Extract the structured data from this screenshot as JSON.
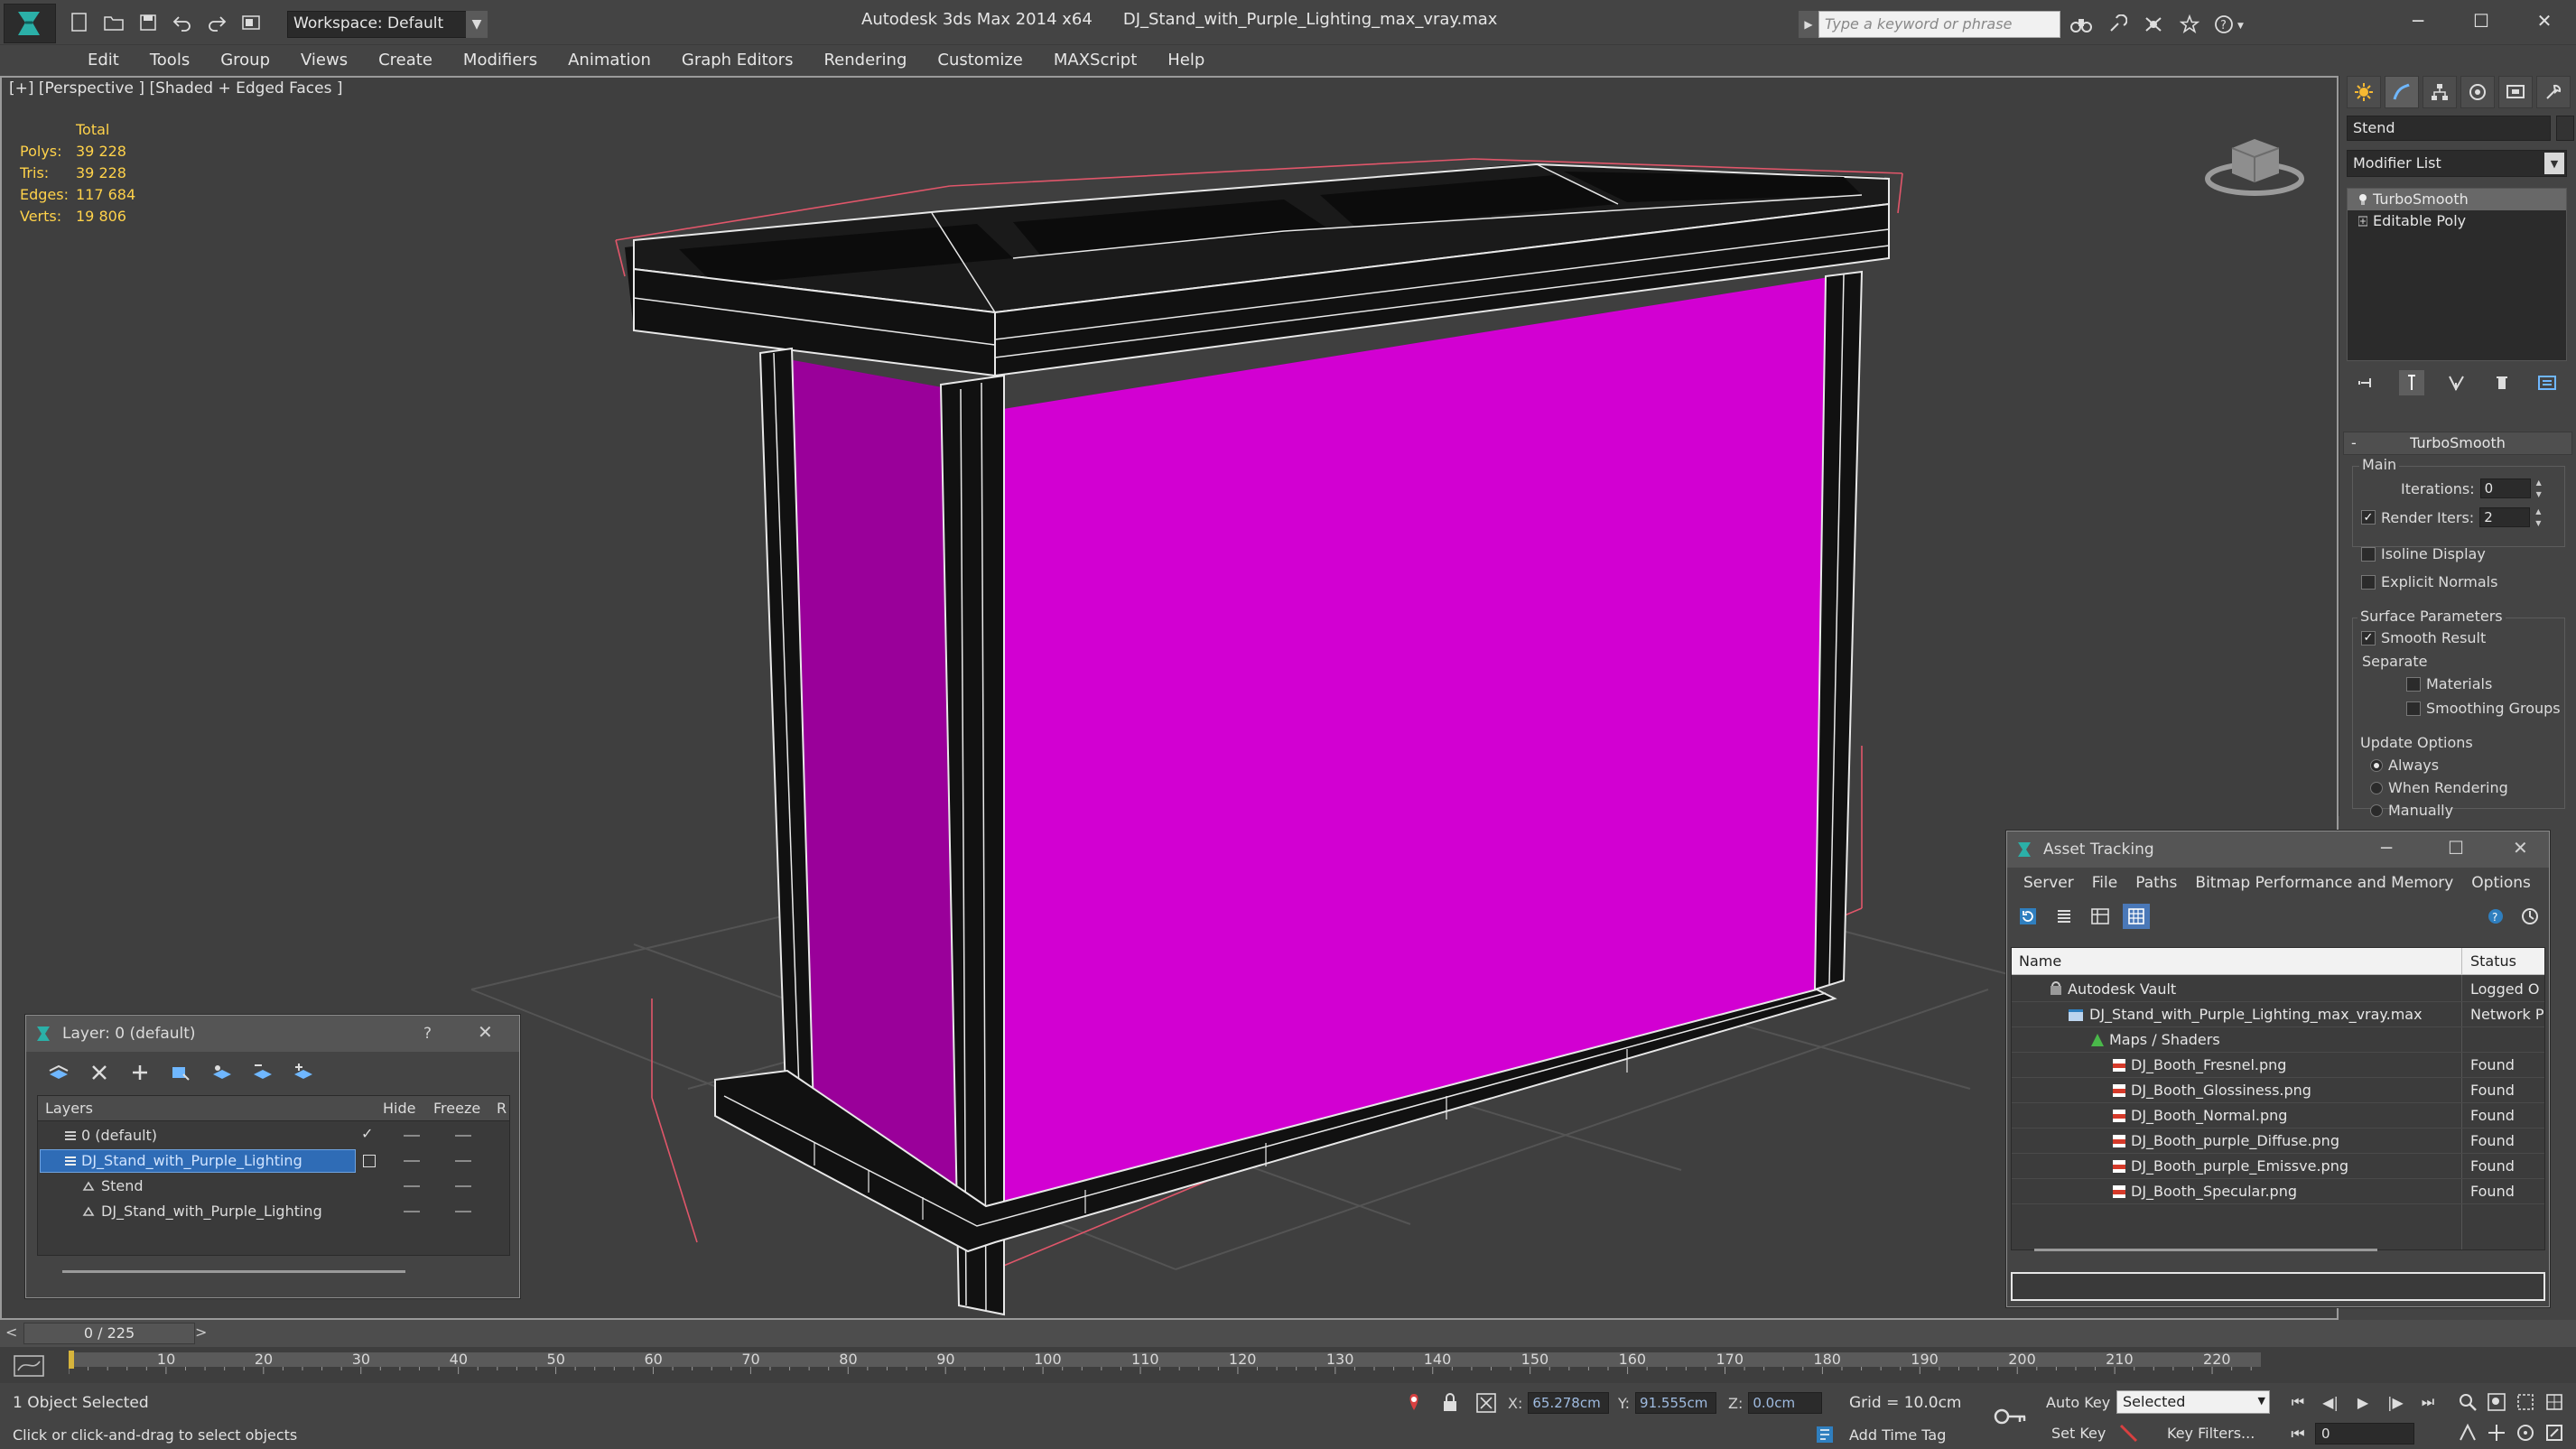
{
  "titlebar": {
    "workspace": "Workspace: Default",
    "app_version": "Autodesk 3ds Max  2014 x64",
    "file_name": "DJ_Stand_with_Purple_Lighting_max_vray.max",
    "search_placeholder": "Type a keyword or phrase"
  },
  "menu": [
    "Edit",
    "Tools",
    "Group",
    "Views",
    "Create",
    "Modifiers",
    "Animation",
    "Graph Editors",
    "Rendering",
    "Customize",
    "MAXScript",
    "Help"
  ],
  "viewport": {
    "label": "[+] [Perspective ] [Shaded + Edged Faces ]",
    "stats": {
      "header": "Total",
      "rows": [
        {
          "k": "Polys:",
          "v": "39 228"
        },
        {
          "k": "Tris:",
          "v": "39 228"
        },
        {
          "k": "Edges:",
          "v": "117 684"
        },
        {
          "k": "Verts:",
          "v": "19 806"
        }
      ]
    },
    "colors": {
      "purple_panel": "#d200d2",
      "purple_side": "#9a009a",
      "selection": "#e0566a"
    }
  },
  "command_panel": {
    "object_name": "Stend",
    "modifier_list": "Modifier List",
    "stack": [
      "TurboSmooth",
      "Editable Poly"
    ],
    "rollout_title": "TurboSmooth",
    "main_label": "Main",
    "iterations_label": "Iterations:",
    "iterations_value": "0",
    "render_iters_label": "Render Iters:",
    "render_iters_value": "2",
    "isoline_label": "Isoline Display",
    "explicit_normals_label": "Explicit Normals",
    "surface_params_label": "Surface Parameters",
    "smooth_result_label": "Smooth Result",
    "separate_label": "Separate",
    "materials_label": "Materials",
    "smoothing_groups_label": "Smoothing Groups",
    "update_options_label": "Update Options",
    "always_label": "Always",
    "when_rendering_label": "When Rendering",
    "manually_label": "Manually"
  },
  "layer_window": {
    "title": "Layer: 0 (default)",
    "help": "?",
    "col_layers": "Layers",
    "col_hide": "Hide",
    "col_freeze": "Freeze",
    "col_r": "R",
    "rows": [
      {
        "name": "0 (default)"
      },
      {
        "name": "DJ_Stand_with_Purple_Lighting"
      },
      {
        "name": "Stend"
      },
      {
        "name": "DJ_Stand_with_Purple_Lighting"
      }
    ]
  },
  "asset_window": {
    "title": "Asset Tracking",
    "menu": [
      "Server",
      "File",
      "Paths",
      "Bitmap Performance and Memory",
      "Options"
    ],
    "col_name": "Name",
    "col_status": "Status",
    "rows": [
      {
        "name": "Autodesk Vault",
        "status": "Logged O"
      },
      {
        "name": "DJ_Stand_with_Purple_Lighting_max_vray.max",
        "status": "Network P"
      },
      {
        "name": "Maps / Shaders",
        "status": ""
      },
      {
        "name": "DJ_Booth_Fresnel.png",
        "status": "Found"
      },
      {
        "name": "DJ_Booth_Glossiness.png",
        "status": "Found"
      },
      {
        "name": "DJ_Booth_Normal.png",
        "status": "Found"
      },
      {
        "name": "DJ_Booth_purple_Diffuse.png",
        "status": "Found"
      },
      {
        "name": "DJ_Booth_purple_Emissve.png",
        "status": "Found"
      },
      {
        "name": "DJ_Booth_Specular.png",
        "status": "Found"
      }
    ]
  },
  "timeline": {
    "frame_range": "0 / 225",
    "ticks": [
      "10",
      "20",
      "30",
      "40",
      "50",
      "60",
      "70",
      "80",
      "90",
      "100",
      "110",
      "120",
      "130",
      "140",
      "150",
      "160",
      "170",
      "180",
      "190",
      "200",
      "210",
      "220"
    ]
  },
  "status": {
    "selected": "1 Object Selected",
    "prompt": "Click or click-and-drag to select objects",
    "x_label": "X:",
    "x_value": "65.278cm",
    "y_label": "Y:",
    "y_value": "91.555cm",
    "z_label": "Z:",
    "z_value": "0.0cm",
    "grid": "Grid = 10.0cm",
    "add_time_tag": "Add Time Tag",
    "auto_key": "Auto Key",
    "set_key": "Set Key",
    "selected_filter": "Selected",
    "key_filters": "Key Filters...",
    "frame": "0"
  }
}
